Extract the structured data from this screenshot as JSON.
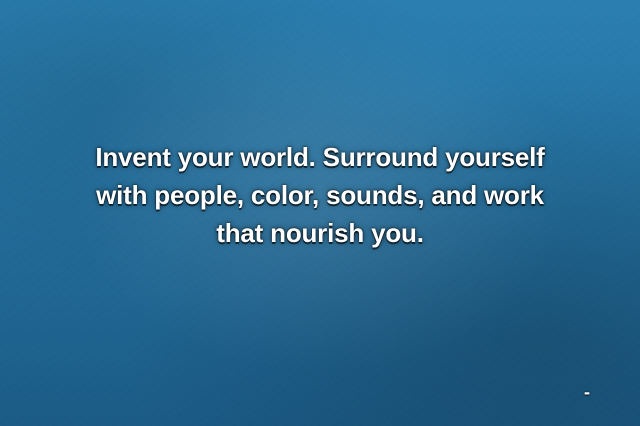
{
  "quote": {
    "text": "Invent your world. Surround yourself with people, color, sounds, and work that nourish you."
  },
  "attribution": {
    "text": "-"
  },
  "colors": {
    "background": "#226c9a",
    "text": "#ffffff"
  }
}
